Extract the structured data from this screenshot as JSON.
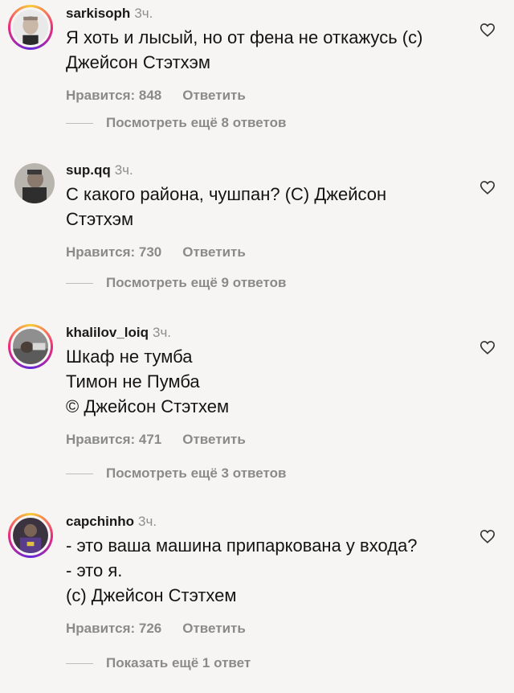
{
  "comments": [
    {
      "username": "sarkisoph",
      "time": "3ч.",
      "lines": [
        "Я хоть и лысый, но от фена не откажусь (с)",
        "Джейсон Стэтхэм"
      ],
      "likes_label": "Нравится: 848",
      "reply_label": "Ответить",
      "more_label": "Посмотреть ещё 8 ответов",
      "story_ring": true
    },
    {
      "username": "sup.qq",
      "time": "3ч.",
      "lines": [
        "С какого района, чушпан? (С) Джейсон",
        "Стэтхэм"
      ],
      "likes_label": "Нравится: 730",
      "reply_label": "Ответить",
      "more_label": "Посмотреть ещё 9 ответов",
      "story_ring": false
    },
    {
      "username": "khalilov_loiq",
      "time": "3ч.",
      "lines": [
        "Шкаф не тумба",
        "Тимон не Пумба",
        "© Джейсон Стэтхем"
      ],
      "likes_label": "Нравится: 471",
      "reply_label": "Ответить",
      "more_label": "Посмотреть ещё 3 ответов",
      "story_ring": true
    },
    {
      "username": "capchinho",
      "time": "3ч.",
      "lines": [
        "- это ваша машина припаркована у входа?",
        "- это я.",
        "(с) Джейсон Стэтхем"
      ],
      "likes_label": "Нравится: 726",
      "reply_label": "Ответить",
      "more_label": "Показать ещё 1 ответ",
      "story_ring": true
    }
  ],
  "icons": {
    "like": "heart-outline-icon"
  },
  "colors": {
    "muted": "#8a8a8a",
    "background": "#f6f5f3"
  }
}
